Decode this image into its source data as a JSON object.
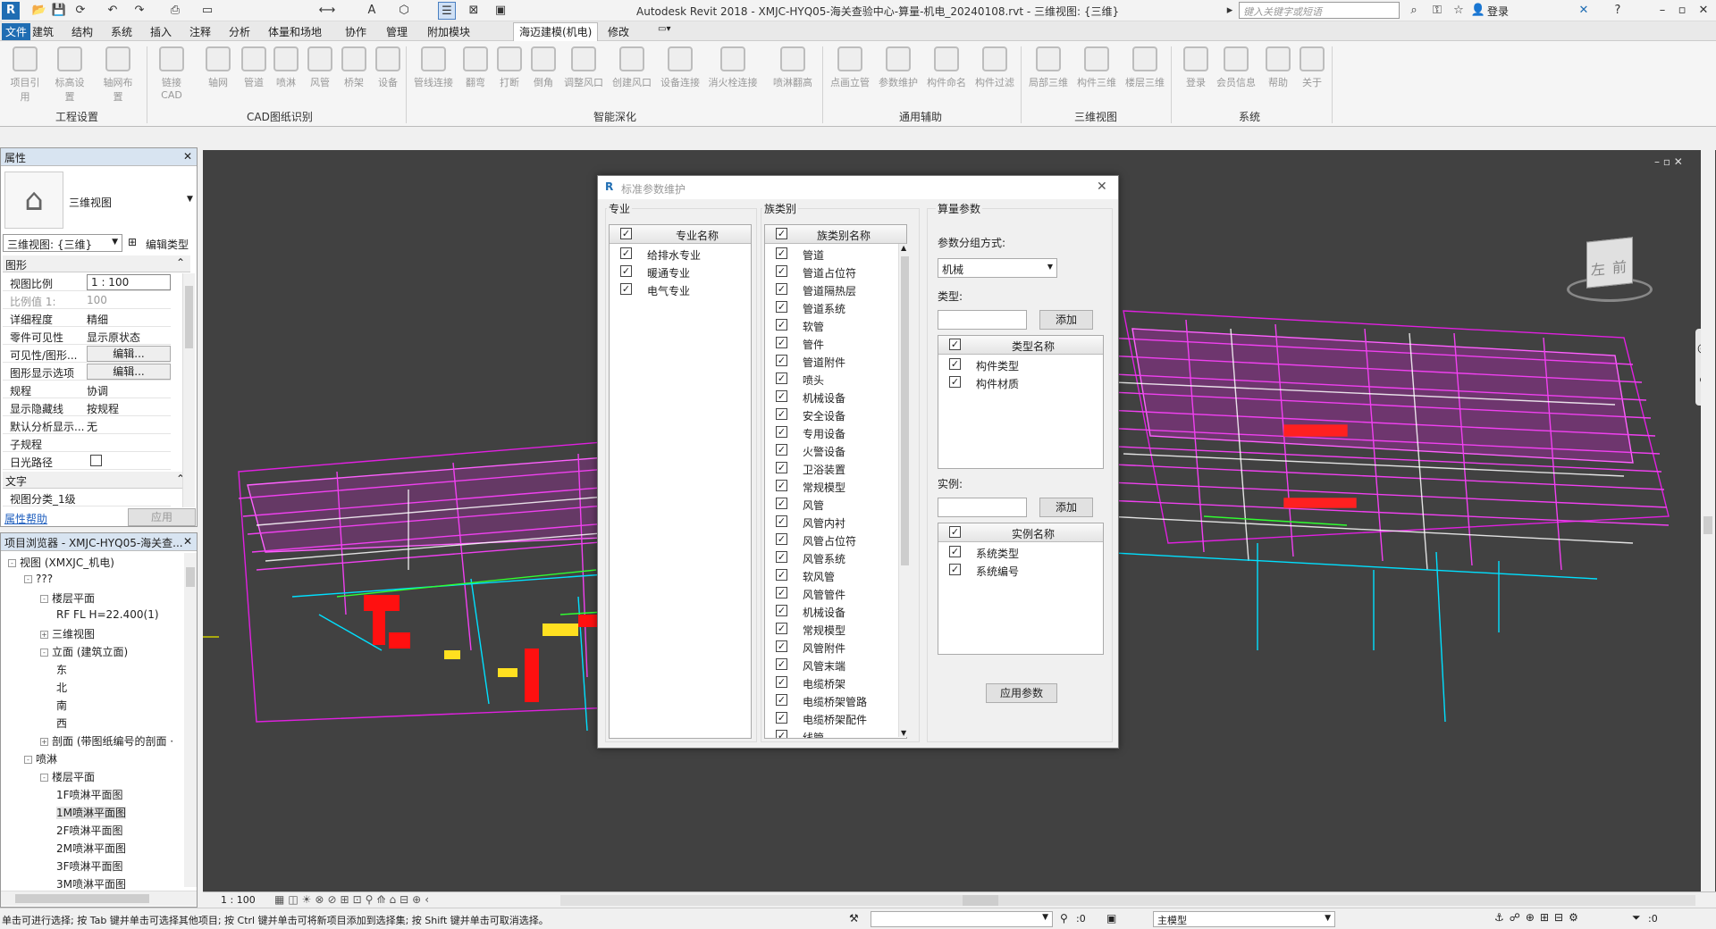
{
  "window": {
    "title": "Autodesk Revit 2018 -    XMJC-HYQ05-海关查验中心-算量-机电_20240108.rvt - 三维视图: {三维}",
    "search_placeholder": "键入关键字或短语",
    "login": "登录"
  },
  "menus": [
    "文件",
    "建筑",
    "结构",
    "系统",
    "插入",
    "注释",
    "分析",
    "体量和场地",
    "协作",
    "管理",
    "附加模块",
    "海迈建模(机电)",
    "修改"
  ],
  "ribbon": {
    "buttons": [
      "项目引用",
      "标高设置",
      "轴网布置",
      "链接CAD",
      "轴网",
      "管道",
      "喷淋",
      "风管",
      "桥架",
      "设备",
      "管线连接",
      "翻弯",
      "打断",
      "倒角",
      "调整风口",
      "创建风口",
      "设备连接",
      "消火栓连接",
      "喷淋翻高",
      "点画立管",
      "参数维护",
      "构件命名",
      "构件过滤",
      "局部三维",
      "构件三维",
      "楼层三维",
      "登录",
      "会员信息",
      "帮助",
      "关于"
    ],
    "groups": [
      "工程设置",
      "CAD图纸识别",
      "智能深化",
      "通用辅助",
      "三维视图",
      "系统"
    ]
  },
  "properties": {
    "title": "属性",
    "type_name": "三维视图",
    "selector": "三维视图: {三维}",
    "edit_type": "编辑类型",
    "section_graphics": "图形",
    "section_text": "文字",
    "rows": [
      {
        "k": "视图比例",
        "v": "1 : 100"
      },
      {
        "k": "比例值 1:",
        "v": "100"
      },
      {
        "k": "详细程度",
        "v": "精细"
      },
      {
        "k": "零件可见性",
        "v": "显示原状态"
      },
      {
        "k": "可见性/图形...",
        "v": "编辑..."
      },
      {
        "k": "图形显示选项",
        "v": "编辑..."
      },
      {
        "k": "规程",
        "v": "协调"
      },
      {
        "k": "显示隐藏线",
        "v": "按规程"
      },
      {
        "k": "默认分析显示...",
        "v": "无"
      },
      {
        "k": "子规程",
        "v": ""
      },
      {
        "k": "日光路径",
        "v": ""
      }
    ],
    "text_row": {
      "k": "视图分类_1级",
      "v": ""
    },
    "help": "属性帮助",
    "apply": "应用"
  },
  "browser": {
    "title": "项目浏览器 - XMJC-HYQ05-海关查...",
    "items": [
      {
        "label": "视图 (XMXJC_机电)",
        "lvl": 0,
        "tg": "-"
      },
      {
        "label": "???",
        "lvl": 1,
        "tg": "-"
      },
      {
        "label": "楼层平面",
        "lvl": 2,
        "tg": "-"
      },
      {
        "label": "RF FL H=22.400(1)",
        "lvl": 3,
        "tg": ""
      },
      {
        "label": "三维视图",
        "lvl": 2,
        "tg": "+"
      },
      {
        "label": "立面 (建筑立面)",
        "lvl": 2,
        "tg": "-"
      },
      {
        "label": "东",
        "lvl": 3,
        "tg": ""
      },
      {
        "label": "北",
        "lvl": 3,
        "tg": ""
      },
      {
        "label": "南",
        "lvl": 3,
        "tg": ""
      },
      {
        "label": "西",
        "lvl": 3,
        "tg": ""
      },
      {
        "label": "剖面 (带图纸编号的剖面 ·",
        "lvl": 2,
        "tg": "+"
      },
      {
        "label": "喷淋",
        "lvl": 1,
        "tg": "-"
      },
      {
        "label": "楼层平面",
        "lvl": 2,
        "tg": "-"
      },
      {
        "label": "1F喷淋平面图",
        "lvl": 3,
        "tg": ""
      },
      {
        "label": "1M喷淋平面图",
        "lvl": 3,
        "tg": ""
      },
      {
        "label": "2F喷淋平面图",
        "lvl": 3,
        "tg": ""
      },
      {
        "label": "2M喷淋平面图",
        "lvl": 3,
        "tg": ""
      },
      {
        "label": "3F喷淋平面图",
        "lvl": 3,
        "tg": ""
      },
      {
        "label": "3M喷淋平面图",
        "lvl": 3,
        "tg": ""
      }
    ]
  },
  "dialog": {
    "title": "标准参数维护",
    "discipline": {
      "label": "专业",
      "header": "专业名称",
      "items": [
        "给排水专业",
        "暖通专业",
        "电气专业"
      ]
    },
    "family": {
      "label": "族类别",
      "header": "族类别名称",
      "items": [
        "管道",
        "管道占位符",
        "管道隔热层",
        "管道系统",
        "软管",
        "管件",
        "管道附件",
        "喷头",
        "机械设备",
        "安全设备",
        "专用设备",
        "火警设备",
        "卫浴装置",
        "常规模型",
        "风管",
        "风管内衬",
        "风管占位符",
        "风管系统",
        "软风管",
        "风管管件",
        "机械设备",
        "常规模型",
        "风管附件",
        "风管末端",
        "电缆桥架",
        "电缆桥架管路",
        "电缆桥架配件",
        "线管"
      ]
    },
    "calc": {
      "label": "算量参数",
      "group_label": "参数分组方式:",
      "group_value": "机械",
      "type_label": "类型:",
      "add": "添加",
      "type_header": "类型名称",
      "type_items": [
        "构件类型",
        "构件材质"
      ],
      "instance_label": "实例:",
      "instance_header": "实例名称",
      "instance_items": [
        "系统类型",
        "系统编号"
      ],
      "apply": "应用参数"
    }
  },
  "viewport": {
    "cube_front": "前",
    "cube_left": "左",
    "scale": "1 : 100"
  },
  "status": {
    "text": "单击可进行选择; 按 Tab 键并单击可选择其他项目; 按 Ctrl 键并单击可将新项目添加到选择集; 按 Shift 键并单击可取消选择。",
    "count": ":0",
    "model": "主模型",
    "filter": ":0"
  }
}
